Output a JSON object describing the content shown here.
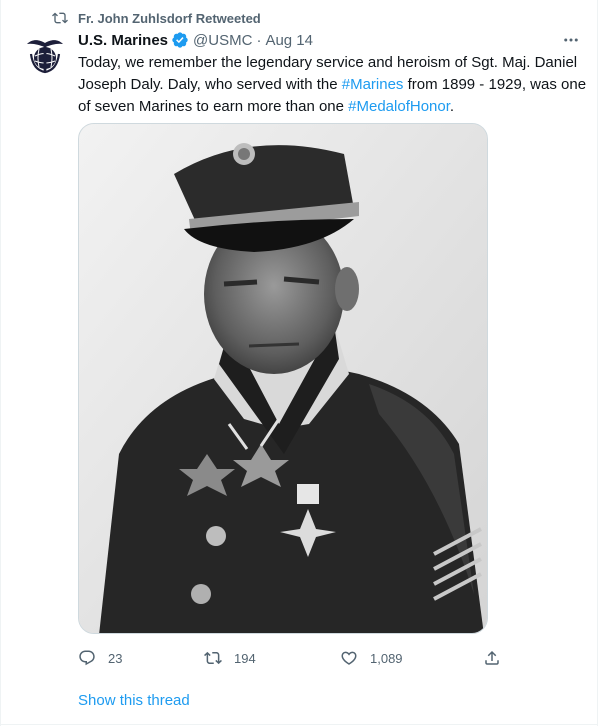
{
  "retweet": {
    "text": "Fr. John Zuhlsdorf Retweeted",
    "icon": "retweet-icon"
  },
  "author": {
    "name": "U.S. Marines",
    "handle": "@USMC",
    "separator": "·",
    "date": "Aug 14",
    "verified": true,
    "avatar_icon": "usmc-emblem"
  },
  "tweet": {
    "text_before_hashtag1": "Today, we remember the legendary service and heroism of Sgt. Maj. Daniel Joseph Daly. Daly, who served with the ",
    "hashtag1": "#Marines",
    "text_between": " from 1899 - 1929, was one of seven Marines to earn more than one ",
    "hashtag2": "#MedalofHonor",
    "text_after": "."
  },
  "media": {
    "kind": "black-and-white portrait photograph of a uniformed Marine with medals"
  },
  "actions": {
    "reply_count": "23",
    "retweet_count": "194",
    "like_count": "1,089"
  },
  "show_thread": "Show this thread",
  "colors": {
    "accent": "#1d9bf0",
    "secondary_text": "#536471",
    "border": "#cfd9de"
  }
}
